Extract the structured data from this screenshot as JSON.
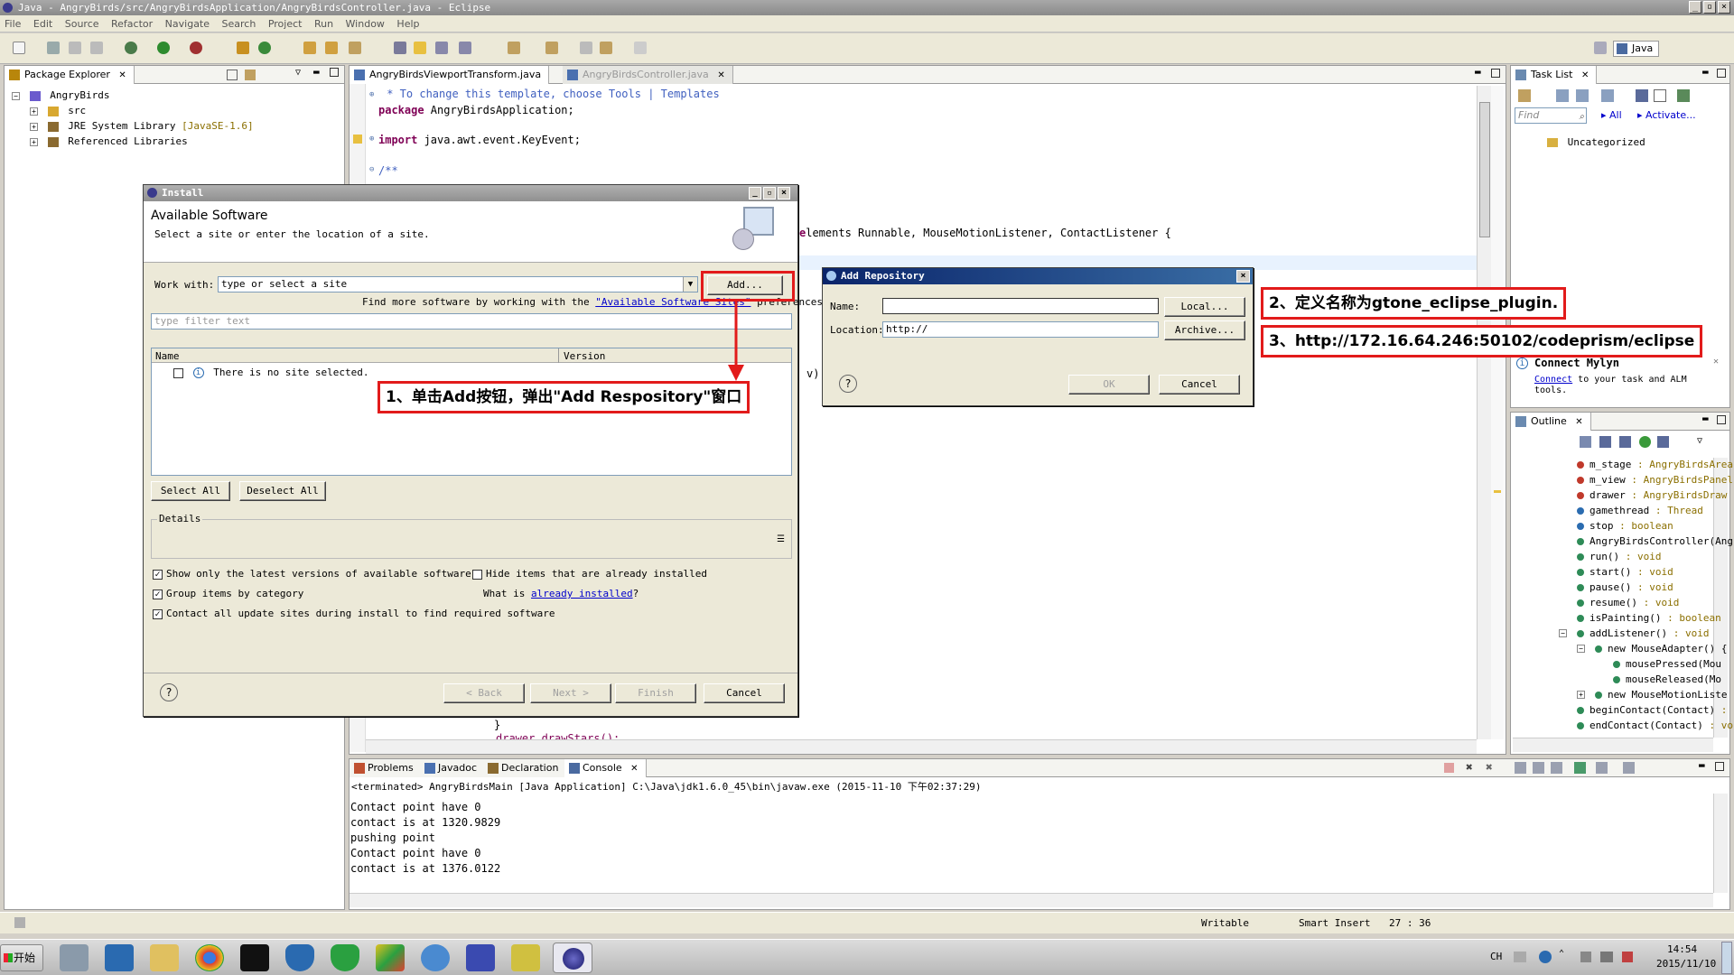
{
  "window": {
    "title": "Java - AngryBirds/src/AngryBirdsApplication/AngryBirdsController.java - Eclipse"
  },
  "menu": [
    "File",
    "Edit",
    "Source",
    "Refactor",
    "Navigate",
    "Search",
    "Project",
    "Run",
    "Window",
    "Help"
  ],
  "perspective": {
    "label": "Java"
  },
  "package_explorer": {
    "title": "Package Explorer",
    "project": "AngryBirds",
    "items": [
      {
        "label": "src",
        "extra": ""
      },
      {
        "label": "JRE System Library",
        "extra": "[JavaSE-1.6]"
      },
      {
        "label": "Referenced Libraries",
        "extra": ""
      }
    ]
  },
  "editor": {
    "tabs": [
      "AngryBirdsViewportTransform.java",
      "AngryBirdsController.java"
    ],
    "lines": [
      {
        "comment": " * To change this template, choose Tools | Templates"
      },
      {
        "kw": "package",
        "text": " AngryBirdsApplication;"
      },
      {
        "kw": "import",
        "text": " java.awt.event.KeyEvent;"
      },
      {
        "comment": "/**"
      }
    ],
    "implements_line": "lements Runnable, MouseMotionListener, ContactListener {",
    "fragment": "v)",
    "brace": "}",
    "bottom_partial": "drawer.drawStars();"
  },
  "install_dialog": {
    "title": "Install",
    "heading": "Available Software",
    "subheading": "Select a site or enter the location of a site.",
    "work_with_label": "Work with:",
    "work_with_value": "type or select a site",
    "add_button": "Add...",
    "more_software_prefix": "Find more software by working with the ",
    "more_software_link": "\"Available Software Sites\"",
    "more_software_suffix": " preferences.",
    "filter_placeholder": "type filter text",
    "col_name": "Name",
    "col_version": "Version",
    "no_site": "There is no site selected.",
    "select_all": "Select All",
    "deselect_all": "Deselect All",
    "details_label": "Details",
    "opt_latest": "Show only the latest versions of available software",
    "opt_hide_installed": "Hide items that are already installed",
    "opt_group": "Group items by category",
    "what_is": "What is ",
    "already_installed": "already installed",
    "what_is_suffix": "?",
    "opt_contact": "Contact all update sites during install to find required software",
    "back": "< Back",
    "next": "Next >",
    "finish": "Finish",
    "cancel": "Cancel"
  },
  "add_repo_dialog": {
    "title": "Add Repository",
    "name_label": "Name:",
    "name_value": "",
    "location_label": "Location:",
    "location_value": "http://",
    "local_button": "Local...",
    "archive_button": "Archive...",
    "ok": "OK",
    "cancel": "Cancel"
  },
  "annotations": {
    "step1": "1、单击Add按钮，弹出\"Add Respository\"窗口",
    "step2": "2、定义名称为gtone_eclipse_plugin.",
    "step3": "3、http://172.16.64.246:50102/codeprism/eclipse"
  },
  "task_list": {
    "title": "Task List",
    "find_placeholder": "Find",
    "all": "All",
    "activate": "Activate...",
    "uncategorized": "Uncategorized"
  },
  "connect_mylyn": {
    "title": "Connect Mylyn",
    "link": "Connect",
    "text": " to your task and ALM tools."
  },
  "outline": {
    "title": "Outline",
    "items": [
      {
        "name": "m_stage",
        "type": " : AngryBirdsArea",
        "color": "#c0392b"
      },
      {
        "name": "m_view",
        "type": " : AngryBirdsPanel",
        "color": "#c0392b"
      },
      {
        "name": "drawer",
        "type": " : AngryBirdsDraw",
        "color": "#c0392b"
      },
      {
        "name": "gamethread",
        "type": " : Thread",
        "color": "#2b6cb0"
      },
      {
        "name": "stop",
        "type": " : boolean",
        "color": "#2b6cb0"
      },
      {
        "name": "AngryBirdsController(Ang",
        "type": "",
        "color": "#2e8b57"
      },
      {
        "name": "run()",
        "type": " : void",
        "color": "#2e8b57"
      },
      {
        "name": "start()",
        "type": " : void",
        "color": "#2e8b57"
      },
      {
        "name": "pause()",
        "type": " : void",
        "color": "#2e8b57"
      },
      {
        "name": "resume()",
        "type": " : void",
        "color": "#2e8b57"
      },
      {
        "name": "isPainting()",
        "type": " : boolean",
        "color": "#2e8b57"
      },
      {
        "name": "addListener()",
        "type": " : void",
        "color": "#2e8b57"
      },
      {
        "name": "new MouseAdapter() {",
        "type": "",
        "color": "#2e8b57"
      },
      {
        "name": "mousePressed(Mou",
        "type": "",
        "color": "#2e8b57"
      },
      {
        "name": "mouseReleased(Mo",
        "type": "",
        "color": "#2e8b57"
      },
      {
        "name": "new MouseMotionListe",
        "type": "",
        "color": "#2e8b57"
      },
      {
        "name": "beginContact(Contact)",
        "type": " :",
        "color": "#2e8b57"
      },
      {
        "name": "endContact(Contact)",
        "type": " : vo",
        "color": "#2e8b57"
      }
    ]
  },
  "bottom_tabs": [
    "Problems",
    "Javadoc",
    "Declaration",
    "Console"
  ],
  "console": {
    "header": "<terminated> AngryBirdsMain [Java Application] C:\\Java\\jdk1.6.0_45\\bin\\javaw.exe (2015-11-10 下午02:37:29)",
    "lines": [
      "Contact point have 0",
      "contact is at 1320.9829",
      "pushing point",
      "Contact point have 0",
      "contact is at 1376.0122"
    ]
  },
  "status": {
    "writable": "Writable",
    "insert": "Smart Insert",
    "position": "27 : 36"
  },
  "taskbar": {
    "start": "开始",
    "lang": "CH",
    "time": "14:54",
    "date": "2015/11/10"
  },
  "colors": {
    "annotation_red": "#e21b1b",
    "dialog_title_blue": "#0a246a",
    "link_blue": "#0000cc"
  }
}
